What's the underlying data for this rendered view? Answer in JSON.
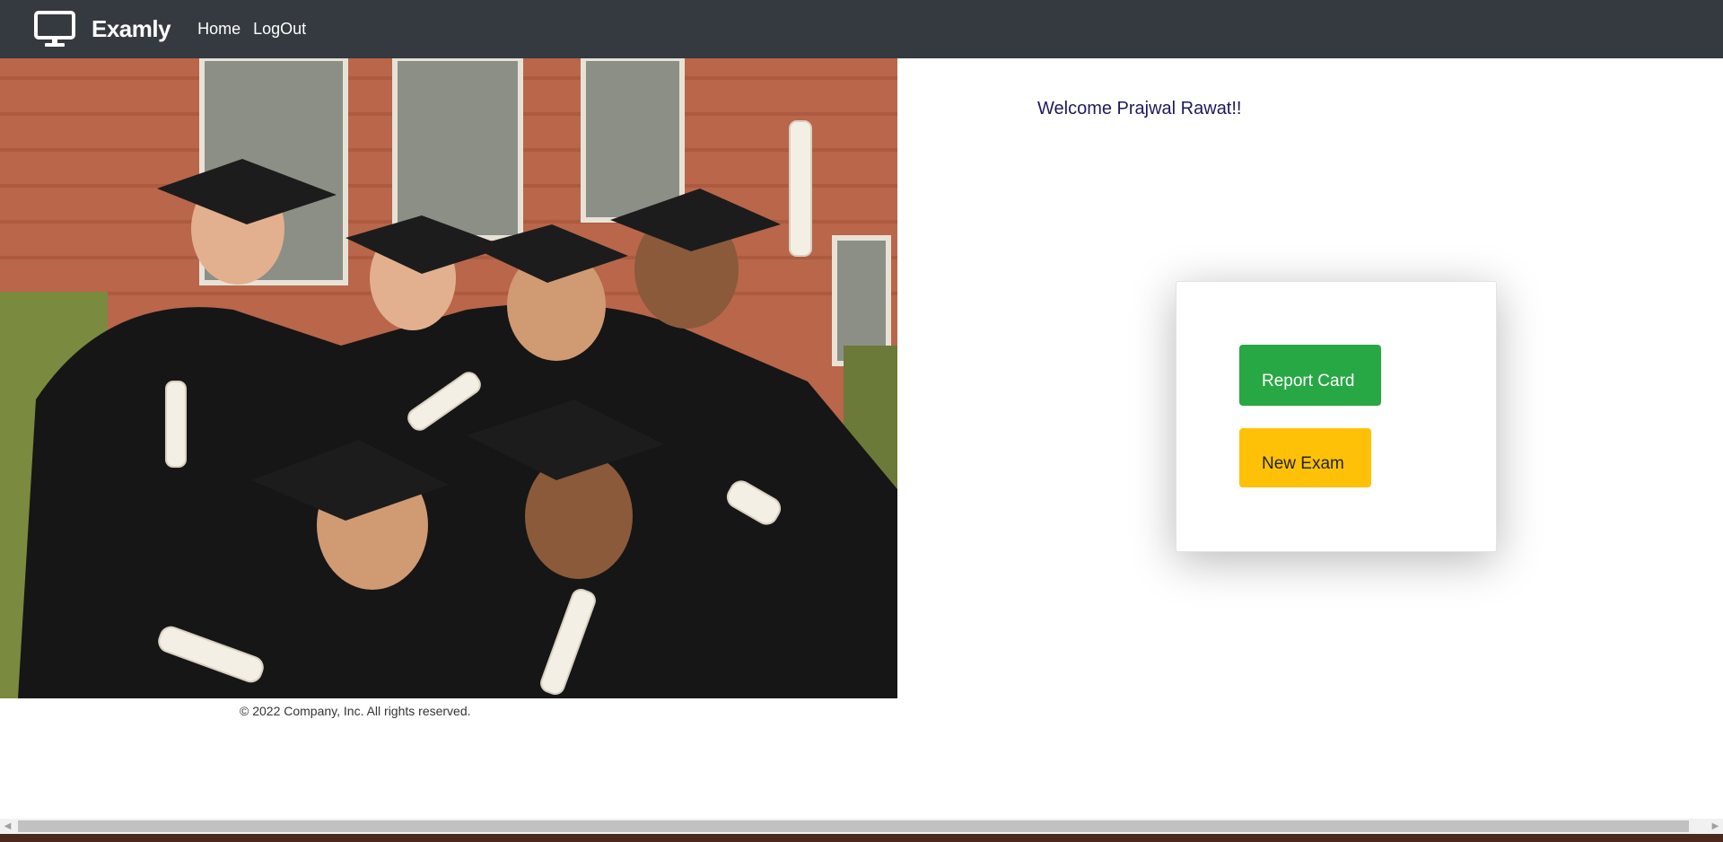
{
  "navbar": {
    "brand": "Examly",
    "brand_icon": "monitor-icon",
    "links": [
      "Home",
      "LogOut"
    ]
  },
  "hero": {
    "image": "graduates-photo"
  },
  "footer": {
    "copyright": "© 2022 Company, Inc. All rights reserved."
  },
  "main": {
    "welcome": "Welcome Prajwal Rawat!!",
    "card": {
      "report_button": "Report Card",
      "new_exam_button": "New Exam"
    }
  },
  "colors": {
    "navbar": "#343a40",
    "report_button": "#28a745",
    "new_exam_button": "#ffc107",
    "welcome_text": "#1f1a5c"
  }
}
